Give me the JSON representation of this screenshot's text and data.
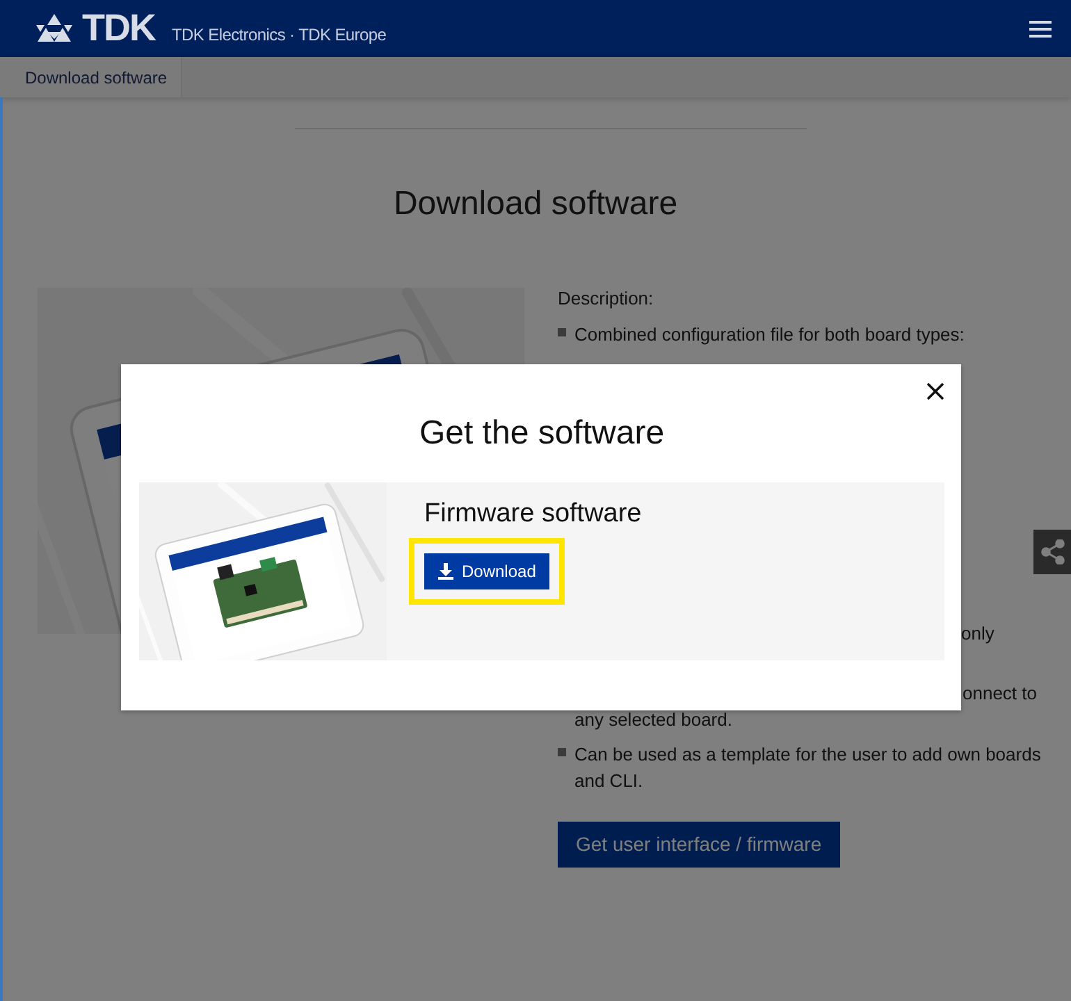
{
  "header": {
    "logo": "TDK",
    "tagline": "TDK Electronics · TDK Europe"
  },
  "breadcrumb": [
    {
      "label": "Download software"
    }
  ],
  "page": {
    "title": "Download software",
    "description": {
      "heading": "Description:",
      "items": [
        {
          "kind": "bullet",
          "text": "Combined configuration file for both board types:"
        },
        {
          "kind": "fragment",
          "text": "only"
        },
        {
          "kind": "fragment",
          "text": "onnect to"
        },
        {
          "kind": "continuation",
          "text": "any selected board."
        },
        {
          "kind": "bullet",
          "text": "Can be used as a template for the user to add own boards and CLI."
        }
      ]
    },
    "cta": "Get user interface / firmware"
  },
  "modal": {
    "title": "Get the software",
    "items": [
      {
        "title": "Firmware software",
        "button": "Download",
        "highlighted": true
      }
    ]
  }
}
